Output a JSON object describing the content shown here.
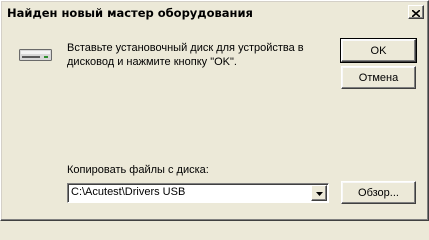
{
  "window": {
    "title": "Найден новый мастер оборудования"
  },
  "icons": {
    "close": "close-icon",
    "drive": "disk-drive-icon",
    "dropdown": "chevron-down-icon"
  },
  "message": {
    "text": "Вставьте установочный диск для устройства в дисковод и нажмите кнопку \"OK\"."
  },
  "buttons": {
    "ok_label": "OK",
    "cancel_label": "Отмена",
    "browse_label": "Обзор..."
  },
  "copy_from": {
    "label": "Копировать файлы с диска:",
    "value": "C:\\Acutest\\Drivers USB"
  },
  "colors": {
    "face": "#ece9d8",
    "highlight": "#ffffff",
    "shadow": "#808080",
    "dark_shadow": "#404040"
  }
}
